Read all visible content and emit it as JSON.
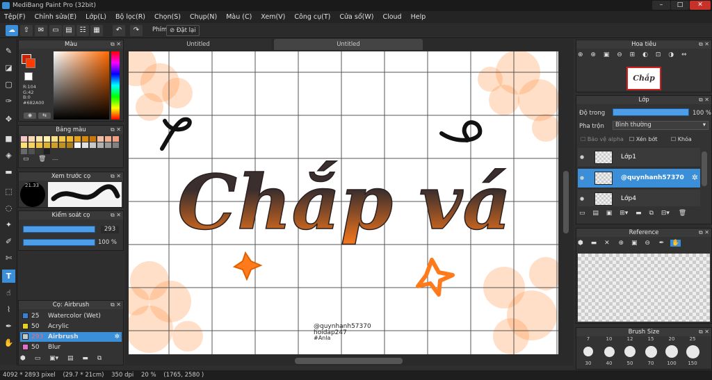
{
  "window": {
    "title": "MediBang Paint Pro (32bit)"
  },
  "menu": [
    "Tệp(F)",
    "Chỉnh sửa(E)",
    "Lớp(L)",
    "Bộ lọc(R)",
    "Chọn(S)",
    "Chụp(N)",
    "Màu (C)",
    "Xem(V)",
    "Công cụ(T)",
    "Cửa sổ(W)",
    "Cloud",
    "Help"
  ],
  "toolbar": {
    "shortcut_label": "Phím",
    "reset_label": "Đặt lại"
  },
  "tabs": [
    "Untitled",
    "Untitled"
  ],
  "color_panel": {
    "title": "Màu",
    "r": "R:104",
    "g": "G:42",
    "b": "B:0",
    "hex": "#682A00"
  },
  "palette_panel": {
    "title": "Bảng màu",
    "more": "---"
  },
  "brush_preview": {
    "title": "Xem trước cọ",
    "size": "21.33"
  },
  "control_panel": {
    "title": "Kiểm soát cọ",
    "size_value": "293",
    "opacity_value": "100 %"
  },
  "brushes_panel": {
    "title": "Cọ: Airbrush",
    "items": [
      {
        "size": "25",
        "name": "Watercolor (Wet)",
        "color": "#3a7fd0"
      },
      {
        "size": "50",
        "name": "Acrylic",
        "color": "#e8d020"
      },
      {
        "size": "293",
        "name": "Airbrush",
        "color": "#c8c8c8"
      },
      {
        "size": "50",
        "name": "Blur",
        "color": "#e070c8"
      }
    ]
  },
  "canvas_text": {
    "main": "Chắp vá",
    "credit1": "@quynhanh57370",
    "credit2": "hoidap247",
    "credit3": "#Anla"
  },
  "navigator": {
    "title": "Hoa tiêu",
    "thumb_text": "Chắp vá"
  },
  "layer_panel": {
    "title": "Lớp",
    "opacity_label": "Độ trong",
    "opacity_value": "100 %",
    "opacity_fraction": 1.0,
    "blend_label": "Pha trộn",
    "blend_value": "Bình thường",
    "protect_alpha": "Bảo vệ alpha",
    "clipping": "Xén bớt",
    "lock": "Khóa",
    "layers": [
      {
        "name": "Lớp1",
        "selected": false
      },
      {
        "name": "@quynhanh57370",
        "selected": true
      },
      {
        "name": "Lớp4",
        "selected": false
      }
    ]
  },
  "reference_panel": {
    "title": "Reference"
  },
  "brush_size_panel": {
    "title": "Brush Size",
    "top": [
      "7",
      "10",
      "12",
      "15",
      "20",
      "25"
    ],
    "bottom": [
      "30",
      "40",
      "50",
      "70",
      "100",
      "150"
    ]
  },
  "status": {
    "pixels": "4092 * 2893 pixel",
    "size": "(29.7 * 21cm)",
    "dpi": "350 dpi",
    "zoom": "20 %",
    "coords": "(1765, 2580 )"
  },
  "colors": {
    "accent": "#3a8fd8",
    "selected_row": "#3a8fd8",
    "orange": "#ff7a1a",
    "fg_color": "#cc2200"
  }
}
